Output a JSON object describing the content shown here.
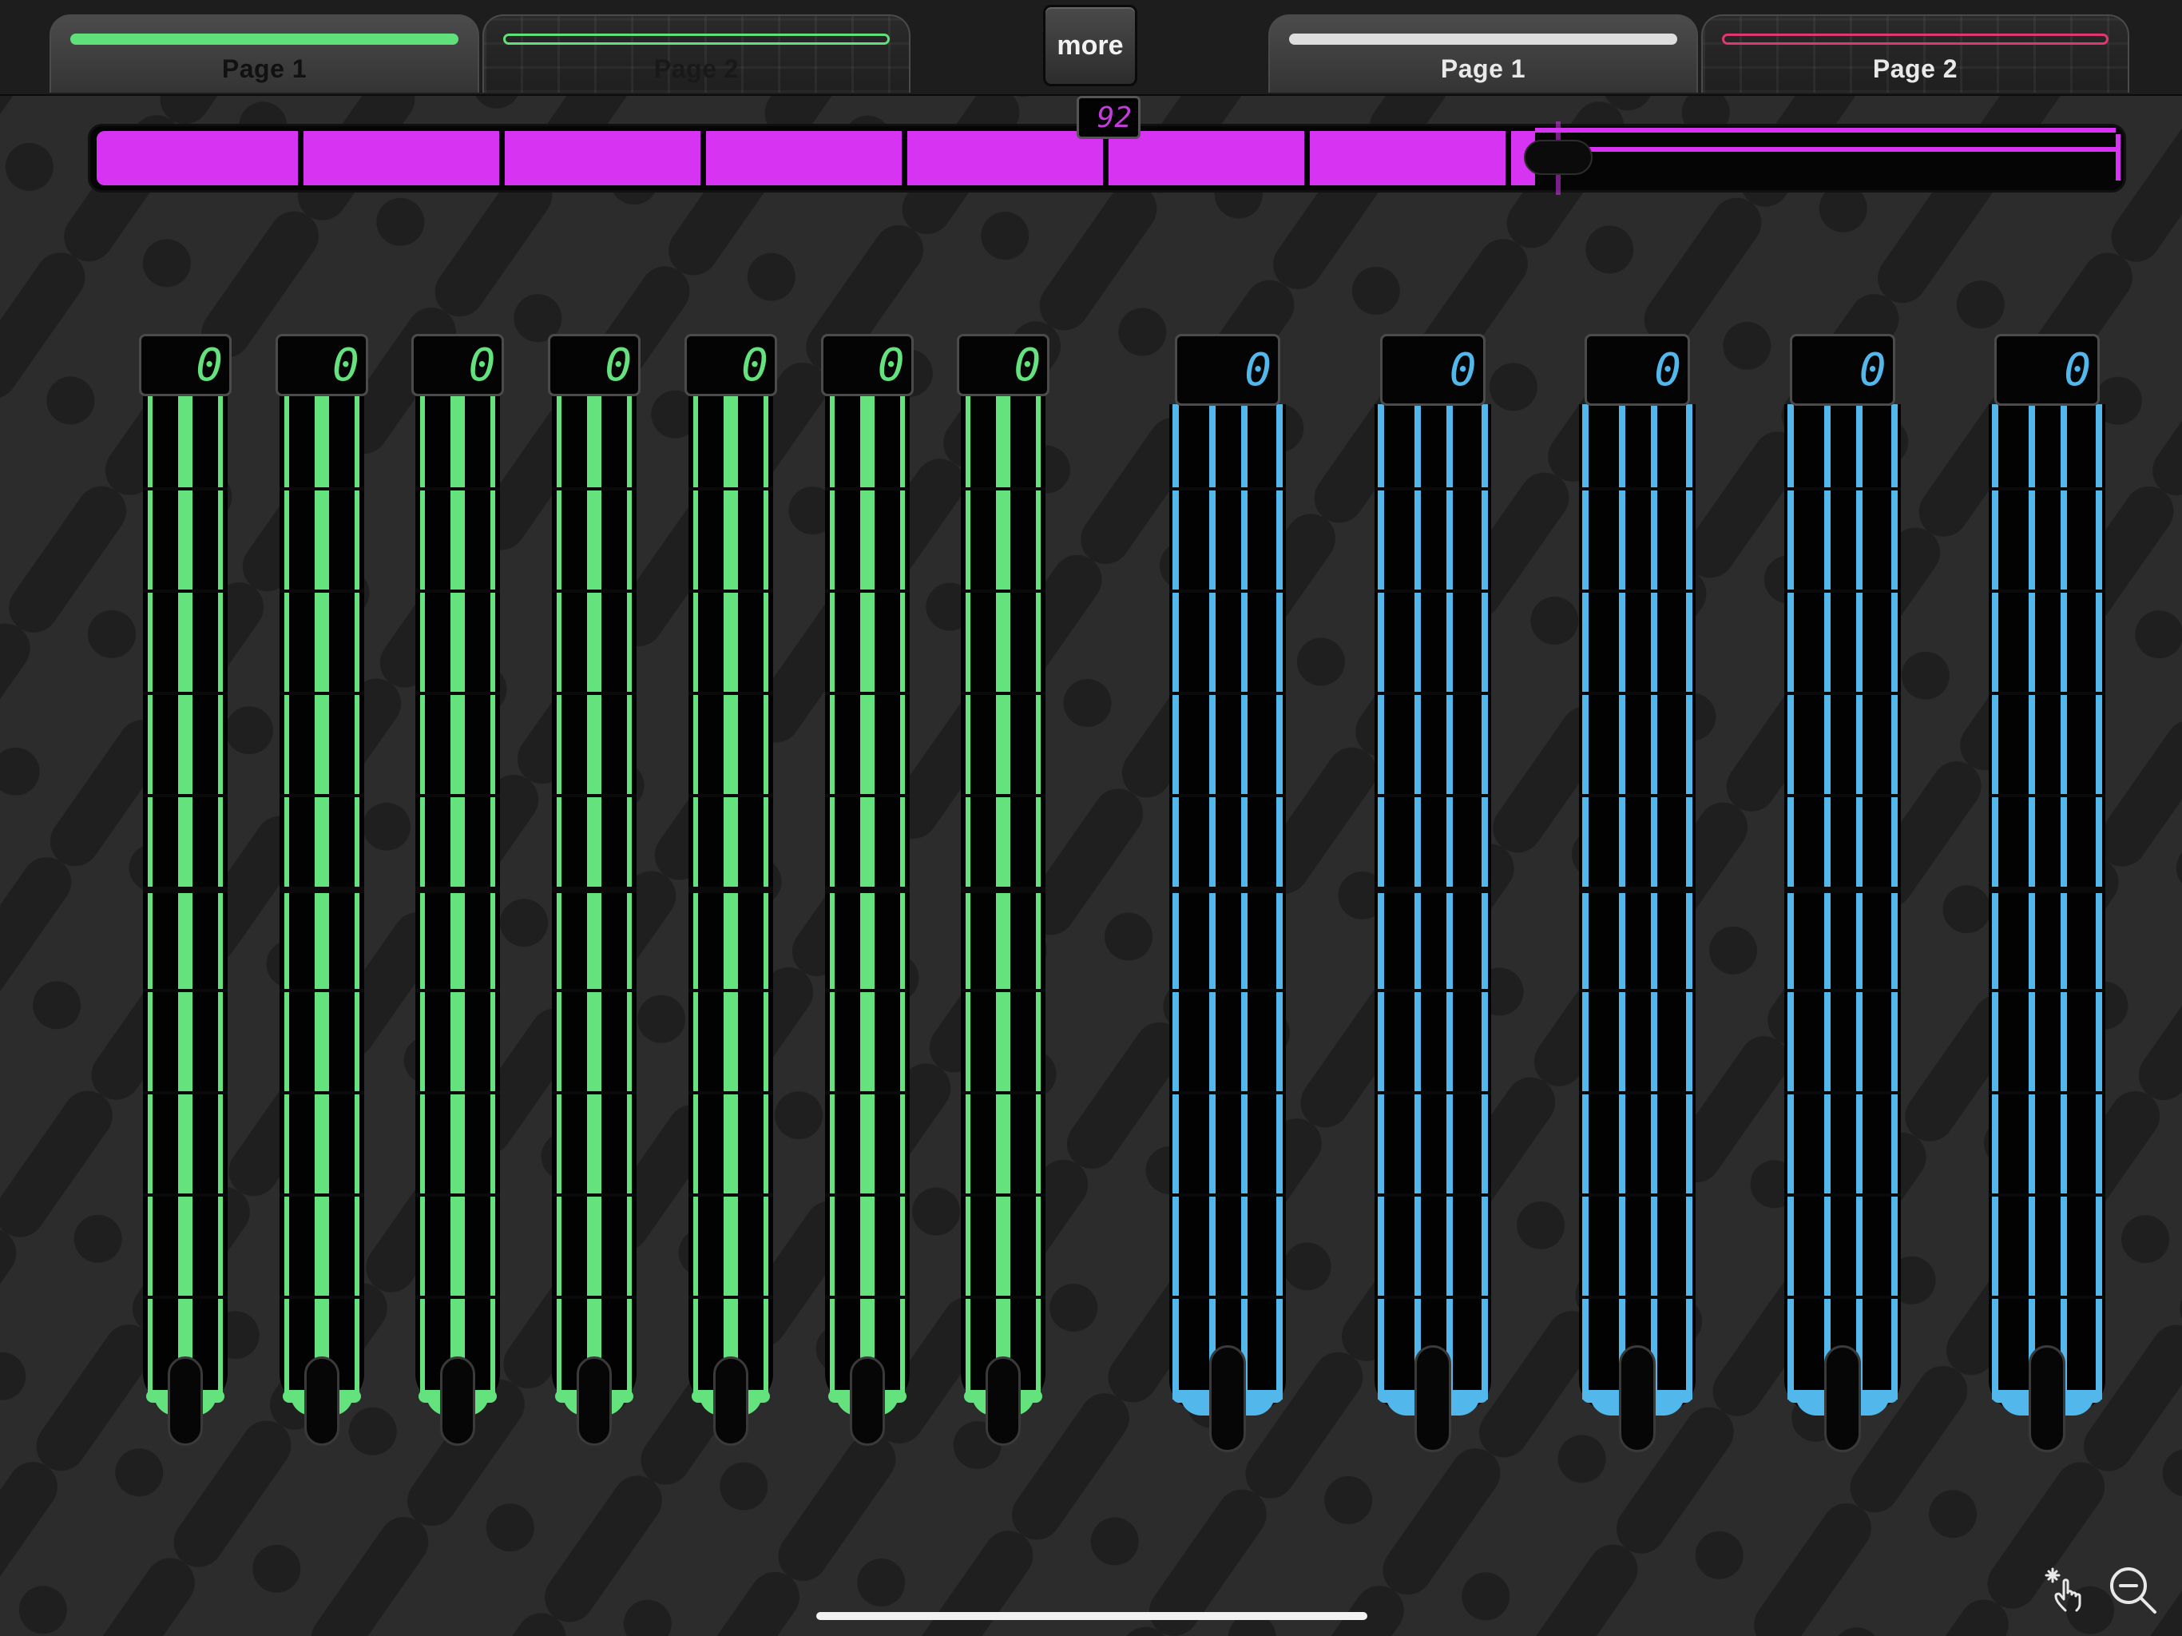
{
  "tabs": [
    {
      "label": "Page 1",
      "color": "#5fe07a",
      "active": true
    },
    {
      "label": "Page 2",
      "color": "#5fe07a",
      "active": false
    },
    {
      "label": "Page 1",
      "color": "#dedede",
      "active": true
    },
    {
      "label": "Page 2",
      "color": "#e0386e",
      "active": false
    }
  ],
  "more_label": "more",
  "horizontal_slider": {
    "value": "92",
    "fraction": 0.71,
    "color": "#d733f3"
  },
  "green_faders": {
    "color": "#63e27e",
    "values": [
      "0",
      "0",
      "0",
      "0",
      "0",
      "0",
      "0"
    ]
  },
  "blue_faders": {
    "color": "#52b8ec",
    "values": [
      "0",
      "0",
      "0",
      "0",
      "0"
    ]
  },
  "icons": {
    "left": "touch-hand-icon",
    "right": "zoom-out-icon"
  }
}
